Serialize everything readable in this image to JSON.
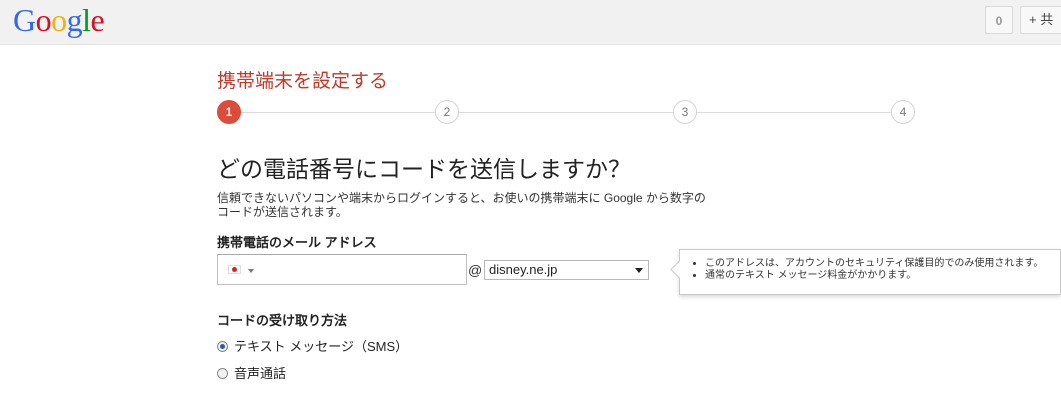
{
  "header": {
    "logo": "Google",
    "logo_colors": [
      "#3369e8",
      "#d50f25",
      "#eeb211",
      "#3369e8",
      "#009925",
      "#d50f25"
    ],
    "notifications_count": "0",
    "share_label": "+ 共"
  },
  "page": {
    "title": "携帯端末を設定する",
    "steps": [
      "1",
      "2",
      "3",
      "4"
    ],
    "active_step": 1,
    "question": "どの電話番号にコードを送信しますか？",
    "description": "信頼できないパソコンや端末からログインすると、お使いの携帯端末に Google から数字のコードが送信されます。"
  },
  "email_section": {
    "label": "携帯電話のメール アドレス",
    "flag": "jp-flag-icon",
    "input_value": "",
    "at_sign": "@",
    "domain_selected": "disney.ne.jp"
  },
  "tooltip": {
    "items": [
      "このアドレスは、アカウントのセキュリティ保護目的でのみ使用されます。",
      "通常のテキスト メッセージ料金がかかります。"
    ]
  },
  "method_section": {
    "label": "コードの受け取り方法",
    "options": [
      {
        "label": "テキスト メッセージ（SMS）",
        "checked": true
      },
      {
        "label": "音声通話",
        "checked": false
      }
    ]
  },
  "colors": {
    "accent_red": "#dd4b39",
    "title_red": "#c0392b"
  }
}
